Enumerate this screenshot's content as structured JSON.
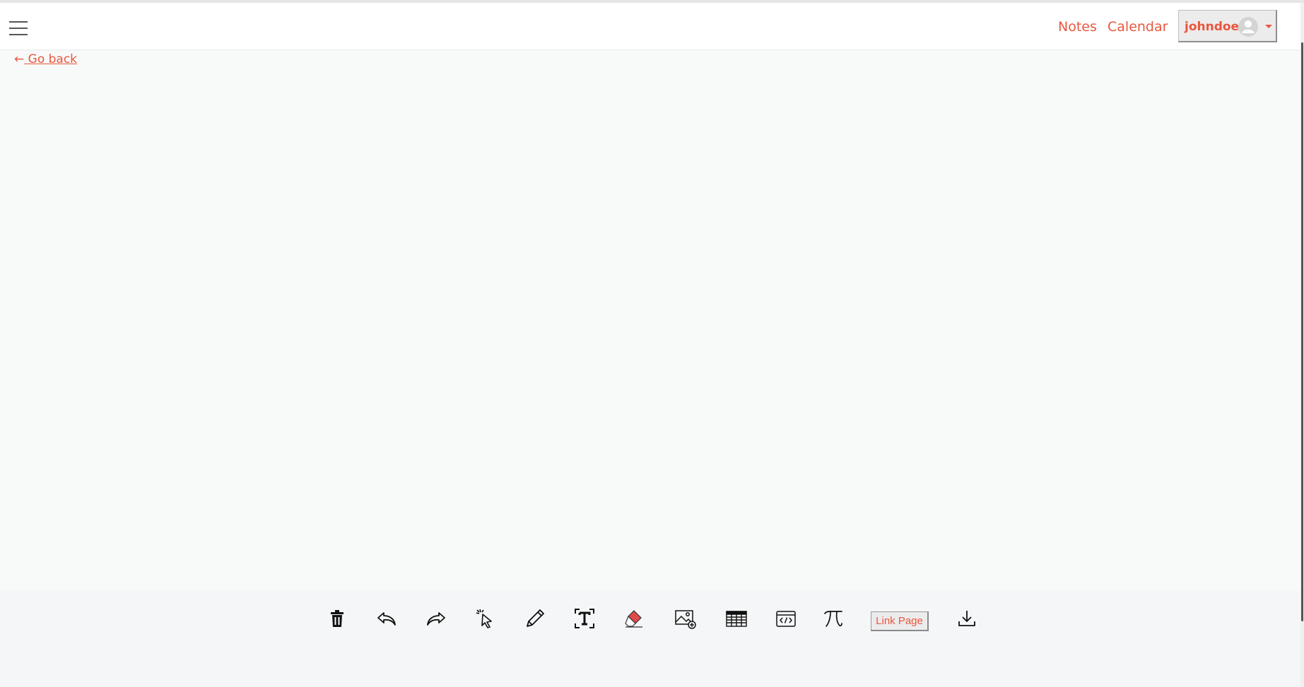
{
  "header": {
    "menu_icon": "hamburger-menu-icon",
    "nav_links": [
      {
        "label": "Notes"
      },
      {
        "label": "Calendar"
      }
    ],
    "user": {
      "username": "johndoe",
      "avatar_icon": "user-avatar-icon",
      "caret_icon": "caret-down-icon"
    }
  },
  "go_back": {
    "arrow": "←",
    "label": " Go back"
  },
  "toolbar": {
    "tools": [
      {
        "name": "delete",
        "icon": "trash-icon"
      },
      {
        "name": "undo",
        "icon": "undo-icon"
      },
      {
        "name": "redo",
        "icon": "redo-icon"
      },
      {
        "name": "select",
        "icon": "select-cursor-icon"
      },
      {
        "name": "pencil",
        "icon": "pencil-icon"
      },
      {
        "name": "text",
        "icon": "text-tool-icon"
      },
      {
        "name": "eraser",
        "icon": "eraser-icon"
      },
      {
        "name": "add-image",
        "icon": "add-image-icon"
      },
      {
        "name": "table",
        "icon": "table-icon"
      },
      {
        "name": "code",
        "icon": "code-block-icon"
      },
      {
        "name": "math",
        "icon": "pi-icon"
      }
    ],
    "link_page_label": "Link Page",
    "download_icon": "download-icon"
  },
  "colors": {
    "accent": "#e9573f",
    "background": "#f8f9f9",
    "eraser": "#e04a4a"
  }
}
